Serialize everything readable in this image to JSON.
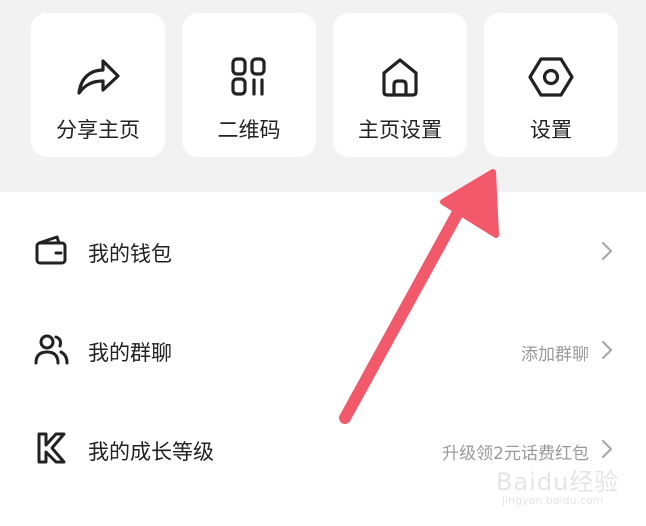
{
  "quick_actions": [
    {
      "label": "分享主页",
      "icon": "share-icon"
    },
    {
      "label": "二维码",
      "icon": "qrcode-icon"
    },
    {
      "label": "主页设置",
      "icon": "home-icon"
    },
    {
      "label": "设置",
      "icon": "settings-hexagon-icon"
    }
  ],
  "menu": [
    {
      "label": "我的钱包",
      "value": "",
      "icon": "wallet-icon"
    },
    {
      "label": "我的群聊",
      "value": "添加群聊",
      "icon": "group-users-icon"
    },
    {
      "label": "我的成长等级",
      "value": "升级领2元话费红包",
      "icon": "growth-level-icon"
    }
  ],
  "annotation": {
    "color": "#f25a6c",
    "points_to": "设置"
  },
  "watermark": {
    "line1": "Baidu经验",
    "line2": "jingyan.baidu.com"
  }
}
